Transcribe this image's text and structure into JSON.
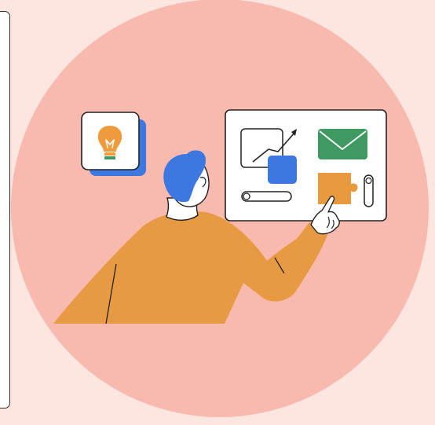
{
  "colors": {
    "page_background": "#fde6df",
    "circle": "#f8b9ae",
    "outline": "#222222",
    "card_white": "#ffffff",
    "accent_blue": "#3d78e0",
    "mail_green": "#3f9a62",
    "puzzle_orange": "#e99a3f",
    "shirt_orange": "#e89a42",
    "skin": "#ffffff",
    "bulb_base_green": "#3f9a62"
  },
  "icons": {
    "idea": "lightbulb-icon",
    "chart": "growth-chart-icon",
    "mail": "envelope-icon",
    "puzzle": "puzzle-piece-icon",
    "slider": "slider-control-icon",
    "toggle": "toggle-control-icon"
  }
}
